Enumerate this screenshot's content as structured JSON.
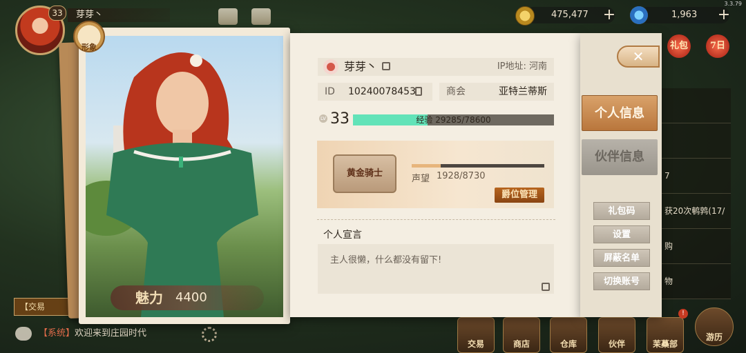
{
  "hud": {
    "version": "3.3.79",
    "level": "33",
    "player_name": "芽芽丶",
    "coins": "475,477",
    "gems": "1,963",
    "plus_label": "+"
  },
  "chat": {
    "tag": "【系统】",
    "message": "欢迎来到庄园时代",
    "trade_hint": "【交易"
  },
  "bottom_nav": [
    "交易",
    "商店",
    "仓库",
    "伙伴",
    "苿蘽部",
    "游历"
  ],
  "bottom_notice": "!",
  "side_bg": {
    "gift_label": "礼包",
    "seven_label": "7日",
    "rows": [
      "",
      "",
      "7",
      "获20次鹌鹑(17/",
      "购",
      "物"
    ]
  },
  "card": {
    "badge_label": "形象",
    "charm_label": "魅力",
    "charm_value": "4400"
  },
  "profile": {
    "name": "芽芽丶",
    "ip": "IP地址: 河南",
    "id_label": "ID",
    "id_value": "10240078453",
    "guild_label": "商会",
    "guild_value": "亚特兰蒂斯",
    "lv_icon": "LV",
    "level": "33",
    "exp_text": "经验 29285/78600",
    "exp_fraction": 0.3726
  },
  "rank": {
    "title": "黄金骑士",
    "rep_label": "声望",
    "rep_value": "1928/8730",
    "rep_fraction": 0.2209,
    "manage_button": "爵位管理"
  },
  "declaration": {
    "title": "个人宣言",
    "text": "主人很懒，什么都没有留下!"
  },
  "side_tabs": {
    "close_label": "✕",
    "personal_info": "个人信息",
    "partner_info": "伙伴信息",
    "buttons": [
      "礼包码",
      "设置",
      "屏蔽名单",
      "切换账号"
    ]
  }
}
